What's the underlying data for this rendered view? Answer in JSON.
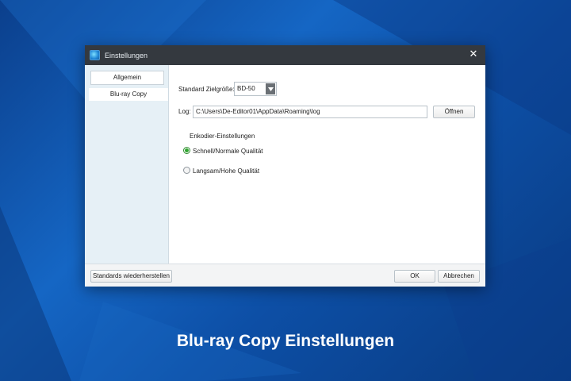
{
  "window": {
    "title": "Einstellungen",
    "close_glyph": "✕"
  },
  "sidebar": {
    "items": [
      {
        "label": "Allgemein"
      },
      {
        "label": "Blu-ray Copy"
      }
    ]
  },
  "settings": {
    "target_size_label": "Standard Zielgröße:",
    "target_size_value": "BD-50",
    "log_label": "Log:",
    "log_path": "C:\\Users\\De-Editor01\\AppData\\Roaming\\log",
    "open_button": "Öffnen",
    "encoder_heading": "Enkodier-Einstellungen",
    "options": [
      {
        "label": "Schnell/Normale Qualität",
        "checked": true
      },
      {
        "label": "Langsam/Hohe Qualität",
        "checked": false
      }
    ]
  },
  "footer": {
    "restore_button": "Standards wiederherstellen",
    "ok_button": "OK",
    "cancel_button": "Abbrechen"
  },
  "caption": "Blu-ray Copy Einstellungen"
}
